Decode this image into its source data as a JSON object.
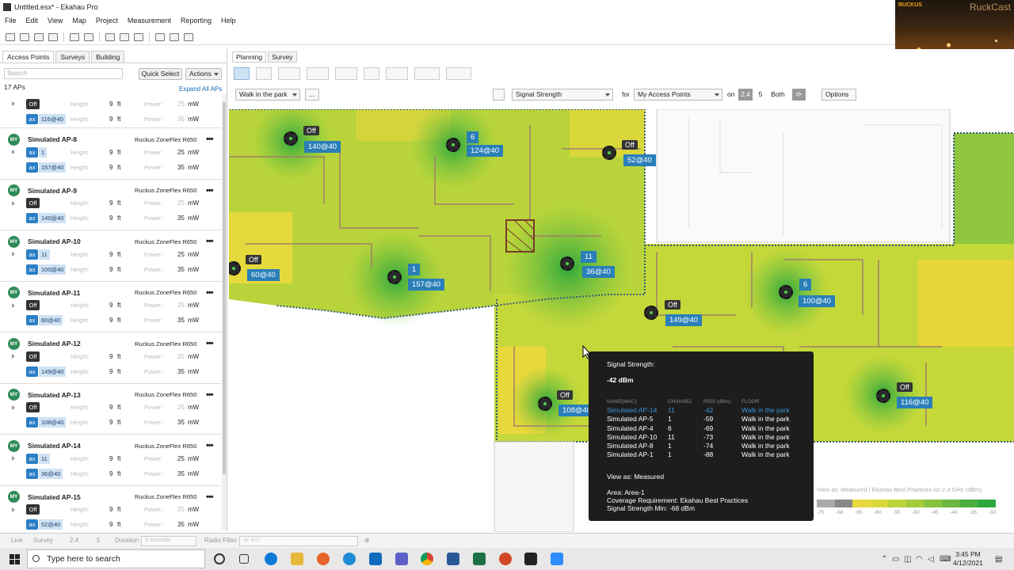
{
  "window": {
    "title": "Untitled.esx* - Ekahau Pro"
  },
  "menu": [
    "File",
    "Edit",
    "View",
    "Map",
    "Project",
    "Measurement",
    "Reporting",
    "Help"
  ],
  "left_panel": {
    "tabs": [
      "Access Points",
      "Surveys",
      "Building"
    ],
    "search_placeholder": "Search",
    "quick_select": "Quick Select",
    "actions": "Actions",
    "ap_count": "17 APs",
    "expand_all": "Expand All APs",
    "height_label": "Height:",
    "power_label": "Power:",
    "aps": [
      {
        "name": "",
        "model": "",
        "radios": [
          {
            "band": "Off",
            "channel": "",
            "height": "9",
            "height_unit": "ft",
            "power": "25",
            "power_unit": "mW",
            "dim": true
          },
          {
            "band": "ax",
            "channel": "116@40",
            "height": "9",
            "height_unit": "ft",
            "power": "35",
            "power_unit": "mW",
            "dim": true
          }
        ]
      },
      {
        "name": "Simulated AP-8",
        "model": "Ruckus ZoneFlex R650",
        "radios": [
          {
            "band": "ax",
            "channel": "1",
            "height": "9",
            "height_unit": "ft",
            "power": "25",
            "power_unit": "mW"
          },
          {
            "band": "ax",
            "channel": "157@40",
            "height": "9",
            "height_unit": "ft",
            "power": "35",
            "power_unit": "mW"
          }
        ]
      },
      {
        "name": "Simulated AP-9",
        "model": "Ruckus ZoneFlex R650",
        "radios": [
          {
            "band": "Off",
            "channel": "",
            "height": "9",
            "height_unit": "ft",
            "power": "25",
            "power_unit": "mW",
            "dim": true
          },
          {
            "band": "ax",
            "channel": "140@40",
            "height": "9",
            "height_unit": "ft",
            "power": "35",
            "power_unit": "mW"
          }
        ]
      },
      {
        "name": "Simulated AP-10",
        "model": "Ruckus ZoneFlex R650",
        "radios": [
          {
            "band": "ax",
            "channel": "11",
            "height": "9",
            "height_unit": "ft",
            "power": "25",
            "power_unit": "mW"
          },
          {
            "band": "ax",
            "channel": "100@40",
            "height": "9",
            "height_unit": "ft",
            "power": "35",
            "power_unit": "mW"
          }
        ]
      },
      {
        "name": "Simulated AP-11",
        "model": "Ruckus ZoneFlex R650",
        "radios": [
          {
            "band": "Off",
            "channel": "",
            "height": "9",
            "height_unit": "ft",
            "power": "25",
            "power_unit": "mW",
            "dim": true
          },
          {
            "band": "ax",
            "channel": "60@40",
            "height": "9",
            "height_unit": "ft",
            "power": "35",
            "power_unit": "mW"
          }
        ]
      },
      {
        "name": "Simulated AP-12",
        "model": "Ruckus ZoneFlex R650",
        "radios": [
          {
            "band": "Off",
            "channel": "",
            "height": "9",
            "height_unit": "ft",
            "power": "25",
            "power_unit": "mW",
            "dim": true
          },
          {
            "band": "ax",
            "channel": "149@40",
            "height": "9",
            "height_unit": "ft",
            "power": "35",
            "power_unit": "mW"
          }
        ]
      },
      {
        "name": "Simulated AP-13",
        "model": "Ruckus ZoneFlex R650",
        "radios": [
          {
            "band": "Off",
            "channel": "",
            "height": "9",
            "height_unit": "ft",
            "power": "25",
            "power_unit": "mW",
            "dim": true
          },
          {
            "band": "ax",
            "channel": "108@40",
            "height": "9",
            "height_unit": "ft",
            "power": "35",
            "power_unit": "mW"
          }
        ]
      },
      {
        "name": "Simulated AP-14",
        "model": "Ruckus ZoneFlex R650",
        "radios": [
          {
            "band": "ax",
            "channel": "11",
            "height": "9",
            "height_unit": "ft",
            "power": "25",
            "power_unit": "mW"
          },
          {
            "band": "ax",
            "channel": "36@40",
            "height": "9",
            "height_unit": "ft",
            "power": "35",
            "power_unit": "mW"
          }
        ]
      },
      {
        "name": "Simulated AP-15",
        "model": "Ruckus ZoneFlex R650",
        "radios": [
          {
            "band": "Off",
            "channel": "",
            "height": "9",
            "height_unit": "ft",
            "power": "25",
            "power_unit": "mW",
            "dim": true
          },
          {
            "band": "ax",
            "channel": "52@40",
            "height": "9",
            "height_unit": "ft",
            "power": "35",
            "power_unit": "mW"
          }
        ]
      }
    ]
  },
  "map": {
    "tabs": [
      "Planning",
      "Survey"
    ],
    "floor": "Walk in the park",
    "more": "...",
    "visualization": "Signal Strength",
    "for_label": "for",
    "for_value": "My Access Points",
    "on_label": "on",
    "bands": [
      "2.4",
      "5",
      "Both"
    ],
    "options": "Options",
    "aps": [
      {
        "off": "Off",
        "channel": "140@40"
      },
      {
        "off": "",
        "channel": "6",
        "channel2": "124@40"
      },
      {
        "off": "Off",
        "channel": "52@40"
      },
      {
        "off": "Off",
        "channel": "60@40"
      },
      {
        "off": "",
        "channel": "1",
        "channel2": "157@40"
      },
      {
        "off": "",
        "channel": "11",
        "channel2": "36@40"
      },
      {
        "off": "",
        "channel": "6",
        "channel2": "100@40"
      },
      {
        "off": "Off",
        "channel": "149@40"
      },
      {
        "off": "Off",
        "channel": "108@40"
      },
      {
        "off": "Off",
        "channel": "116@40"
      }
    ]
  },
  "tooltip": {
    "title": "Signal Strength:",
    "value": "-42 dBm",
    "headers": [
      "NAME(MAC)",
      "CHANNEL",
      "RSSI (dBm)",
      "FLOOR"
    ],
    "rows": [
      {
        "name": "Simulated AP-14",
        "channel": "11",
        "rssi": "-42",
        "floor": "Walk in the park",
        "highlight": true
      },
      {
        "name": "Simulated AP-5",
        "channel": "1",
        "rssi": "-59",
        "floor": "Walk in the park"
      },
      {
        "name": "Simulated AP-4",
        "channel": "6",
        "rssi": "-69",
        "floor": "Walk in the park"
      },
      {
        "name": "Simulated AP-10",
        "channel": "11",
        "rssi": "-73",
        "floor": "Walk in the park"
      },
      {
        "name": "Simulated AP-8",
        "channel": "1",
        "rssi": "-74",
        "floor": "Walk in the park"
      },
      {
        "name": "Simulated AP-1",
        "channel": "1",
        "rssi": "-88",
        "floor": "Walk in the park"
      }
    ],
    "view_as": "View as: Measured",
    "area": "Area: Area-1",
    "coverage": "Coverage Requirement: Ekahau Best Practices",
    "min": "Signal Strength Min: -68 dBm"
  },
  "legend": {
    "title": "View as: Measured  |  Ekahau Best Practices for 2.4 GHz (dBm)",
    "ticks": [
      "-75",
      "-68",
      "-65",
      "-60",
      "-55",
      "-50",
      "-45",
      "-40",
      "-35",
      "-30"
    ]
  },
  "statusbar": {
    "live": "Live",
    "survey": "Survey",
    "band1": "2.4",
    "band2": "5",
    "duration": "Duration",
    "duration_val": "5 seconds",
    "radio_filter": "Radio Filter",
    "radio_val": "ax 802"
  },
  "webcam": {
    "brand": "RUCKUS",
    "subtitle": "RuckCast"
  },
  "taskbar": {
    "search": "Type here to search",
    "time": "3:45 PM",
    "date": "4/12/2021"
  }
}
